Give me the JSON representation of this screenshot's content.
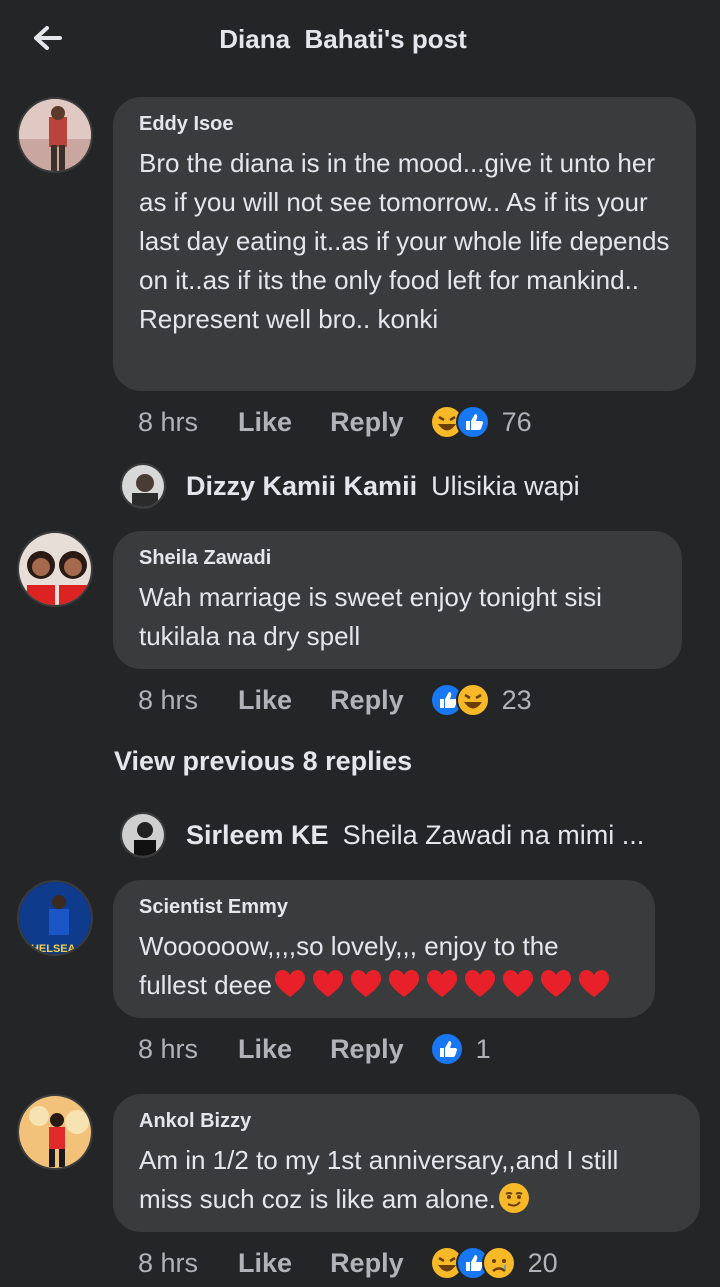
{
  "header": {
    "title": "Diana  Bahati's post"
  },
  "comments": [
    {
      "author": "Eddy Isoe",
      "text": "Bro the diana is in the mood...give it unto her as if you will not see tomorrow.. As if its your last day eating it..as if your whole life depends on it..as if its the only food left for mankind.. Represent well bro.. konki",
      "time": "8 hrs",
      "like": "Like",
      "reply": "Reply",
      "count": "76",
      "reactions": [
        "haha-icon",
        "like-icon"
      ]
    },
    {
      "author": "Sheila Zawadi",
      "text": "Wah marriage is sweet enjoy tonight sisi tukilala na dry spell",
      "time": "8 hrs",
      "like": "Like",
      "reply": "Reply",
      "count": "23",
      "reactions": [
        "like-icon",
        "haha-icon"
      ]
    },
    {
      "author": "Scientist Emmy",
      "text": "Woooooow,,,,so lovely,,, enjoy to the fullest deee",
      "hearts": 9,
      "time": "8 hrs",
      "like": "Like",
      "reply": "Reply",
      "count": "1",
      "reactions": [
        "like-icon"
      ]
    },
    {
      "author": "Ankol Bizzy",
      "text": "Am in 1/2 to my 1st anniversary,,and I still miss such coz is like am alone.",
      "time": "8 hrs",
      "like": "Like",
      "reply": "Reply",
      "count": "20",
      "reactions": [
        "haha-icon",
        "like-icon",
        "sad-icon"
      ]
    }
  ],
  "replies": [
    {
      "name": "Dizzy Kamii Kamii",
      "text": "Ulisikia wapi"
    },
    {
      "name": "Sirleem KE",
      "text": "Sheila Zawadi na mimi ..."
    }
  ],
  "view_previous": "View previous 8 replies",
  "colors": {
    "background": "#242526",
    "bubble": "#3a3b3c",
    "meta": "#b0b3b8",
    "like_blue": "#1877f2"
  }
}
